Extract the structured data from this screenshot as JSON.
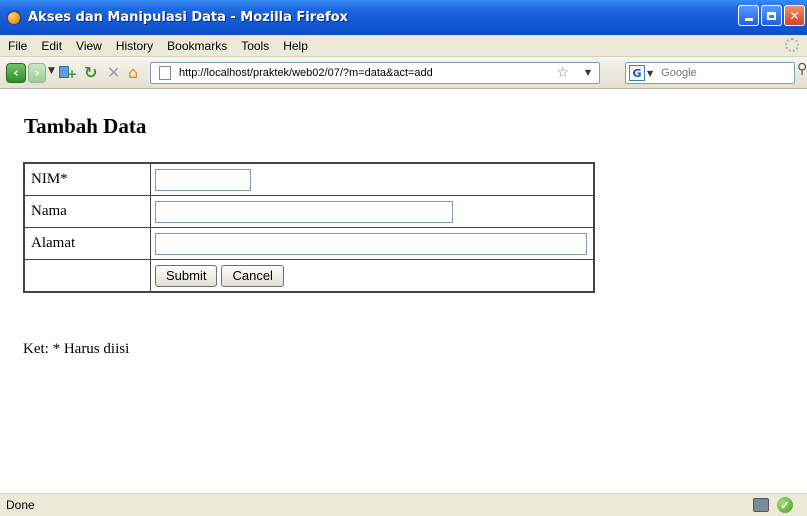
{
  "window": {
    "title": "Akses dan Manipulasi Data - Mozilla Firefox"
  },
  "menu": {
    "items": [
      "File",
      "Edit",
      "View",
      "History",
      "Bookmarks",
      "Tools",
      "Help"
    ]
  },
  "navbar": {
    "url": "http://localhost/praktek/web02/07/?m=data&act=add",
    "search_placeholder": "Google",
    "search_engine_letter": "G"
  },
  "page": {
    "title": "Tambah Data",
    "form": {
      "nim_label": "NIM*",
      "nama_label": "Nama",
      "alamat_label": "Alamat",
      "nim_value": "",
      "nama_value": "",
      "alamat_value": "",
      "submit_label": "Submit",
      "cancel_label": "Cancel"
    },
    "note": "Ket: * Harus diisi"
  },
  "status": {
    "text": "Done"
  },
  "colors": {
    "titlebar": "#155bd7",
    "chrome": "#ece9d8"
  }
}
